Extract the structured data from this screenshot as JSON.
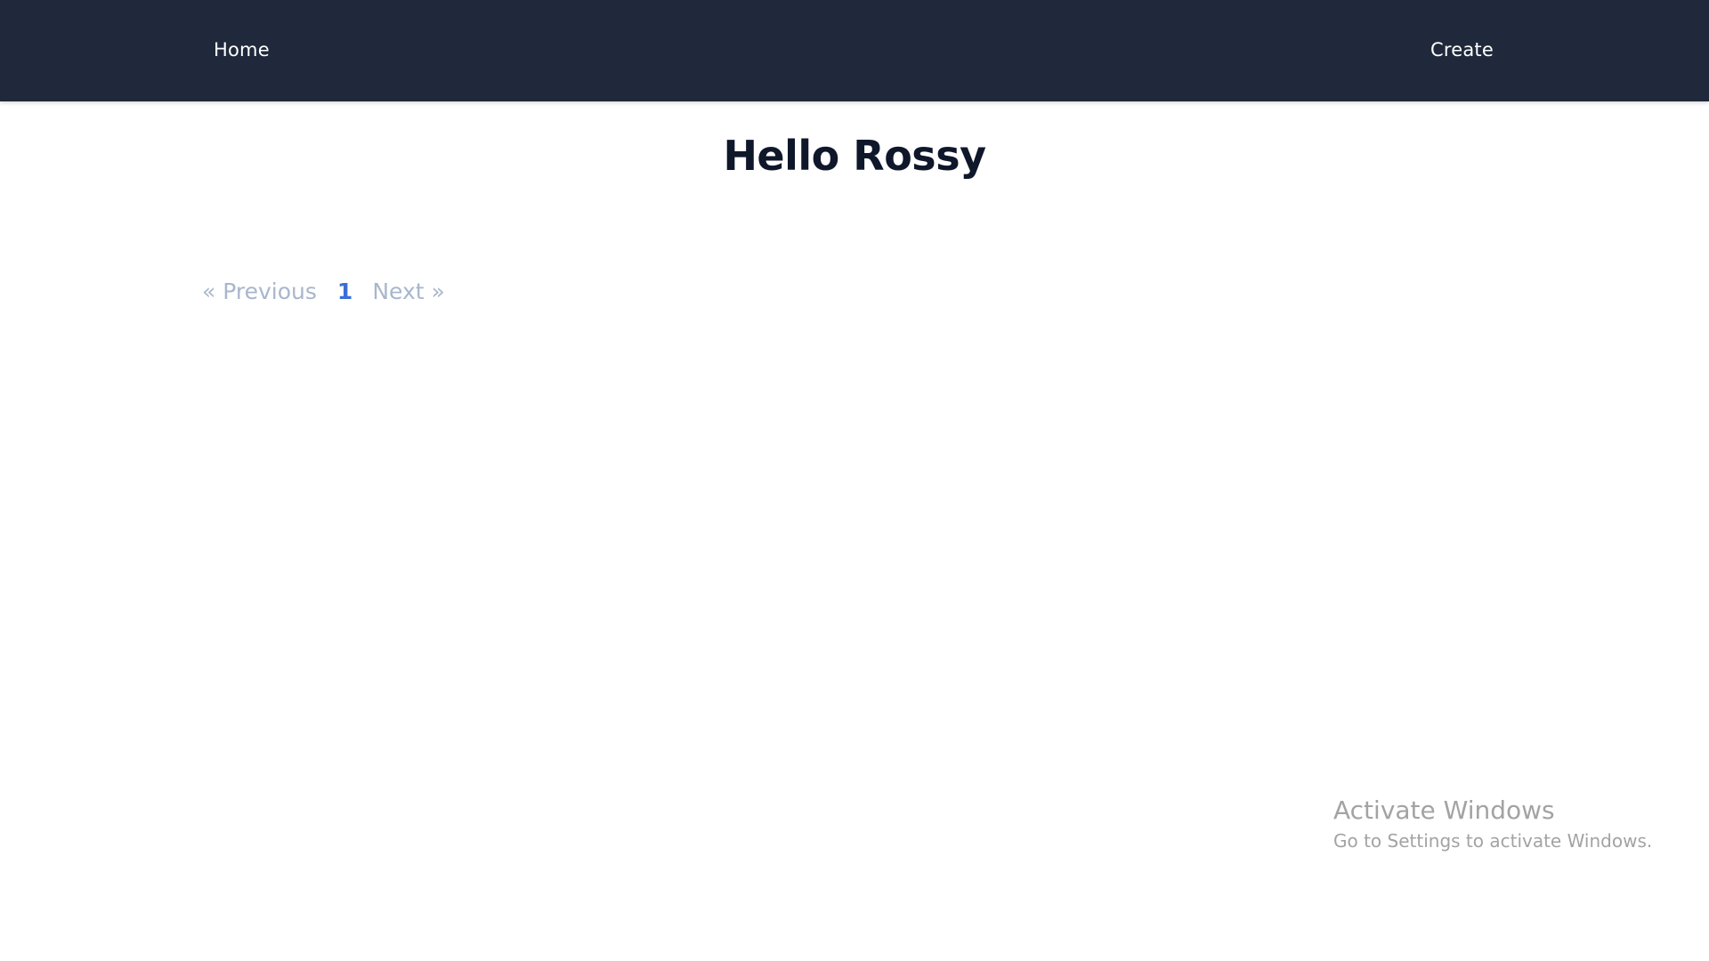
{
  "navbar": {
    "home_label": "Home",
    "create_label": "Create",
    "background": "#1f293b"
  },
  "main": {
    "greeting": "Hello Rossy"
  },
  "pagination": {
    "previous_label": "« Previous",
    "current_page": "1",
    "next_label": "Next »",
    "accent_color": "#3b6fd8"
  },
  "watermark": {
    "title": "Activate Windows",
    "subtitle": "Go to Settings to activate Windows."
  }
}
